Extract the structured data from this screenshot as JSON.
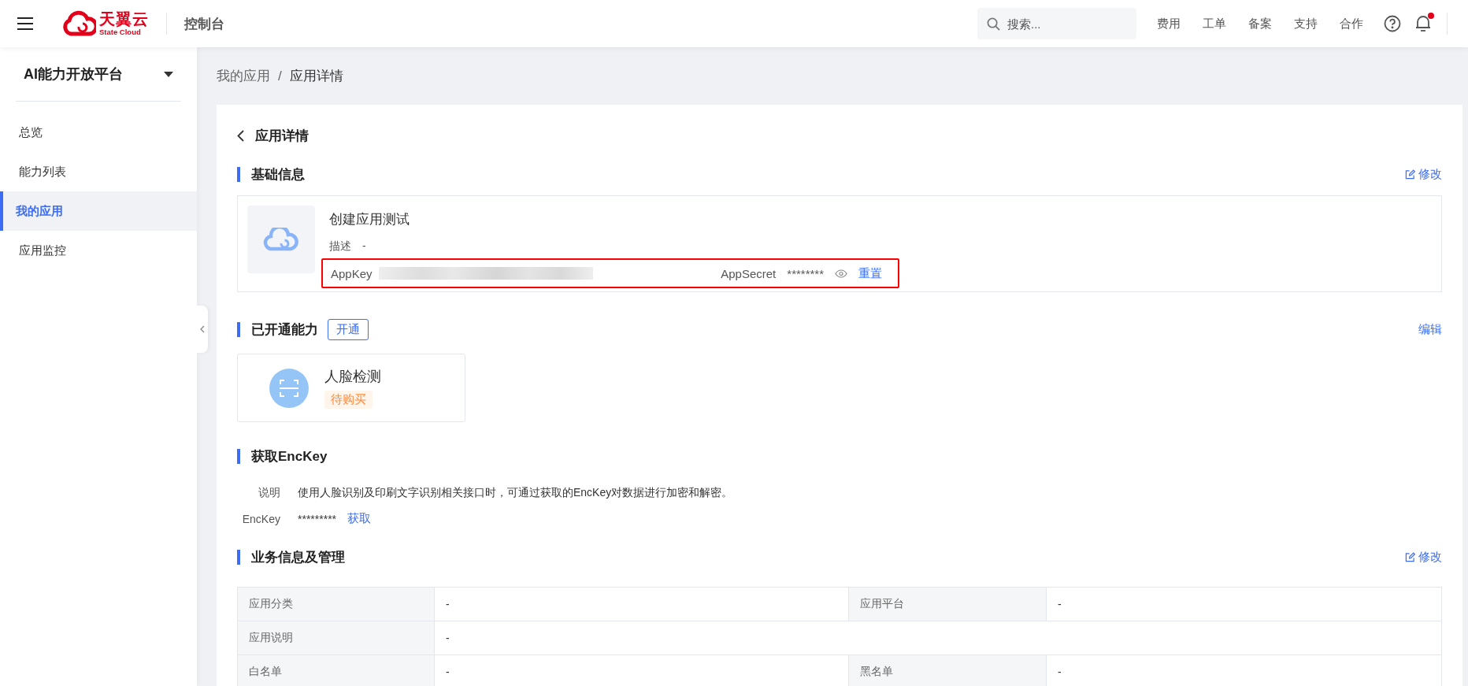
{
  "header": {
    "brand": "天翼云",
    "brand_sub": "State Cloud",
    "console_label": "控制台",
    "search": {
      "placeholder": "搜索..."
    },
    "nav_links": [
      "费用",
      "工单",
      "备案",
      "支持",
      "合作"
    ],
    "notification_dot": true
  },
  "sidebar": {
    "platform": "AI能力开放平台",
    "items": [
      {
        "label": "总览",
        "selected": false
      },
      {
        "label": "能力列表",
        "selected": false
      },
      {
        "label": "我的应用",
        "selected": true
      },
      {
        "label": "应用监控",
        "selected": false
      }
    ]
  },
  "breadcrumb": {
    "items": [
      "我的应用",
      "应用详情"
    ],
    "separator": "/"
  },
  "page_title": "应用详情",
  "basic_info": {
    "title": "基础信息",
    "edit_link": "修改",
    "app_name": "创建应用测试",
    "description_label": "描述",
    "description_value": "-",
    "appkey_label": "AppKey",
    "appsecret_label": "AppSecret",
    "appsecret_value": "********",
    "reset_link": "重置",
    "highlighted": true
  },
  "abilities": {
    "title": "已开通能力",
    "open_button": "开通",
    "edit_link": "编辑",
    "items": [
      {
        "name": "人脸检测",
        "status": "待购买"
      }
    ]
  },
  "enckey": {
    "title": "获取EncKey",
    "rows": [
      {
        "label": "说明",
        "value": "使用人脸识别及印刷文字识别相关接口时，可通过获取的EncKey对数据进行加密和解密。"
      },
      {
        "label": "EncKey",
        "value": "*********",
        "link": "获取"
      }
    ]
  },
  "business": {
    "title": "业务信息及管理",
    "edit_link": "修改",
    "rows": [
      [
        {
          "label": "应用分类",
          "value": "-"
        },
        {
          "label": "应用平台",
          "value": "-"
        }
      ],
      [
        {
          "label": "应用说明",
          "value": "-"
        }
      ],
      [
        {
          "label": "白名单",
          "value": "-"
        },
        {
          "label": "黑名单",
          "value": "-"
        }
      ]
    ]
  }
}
